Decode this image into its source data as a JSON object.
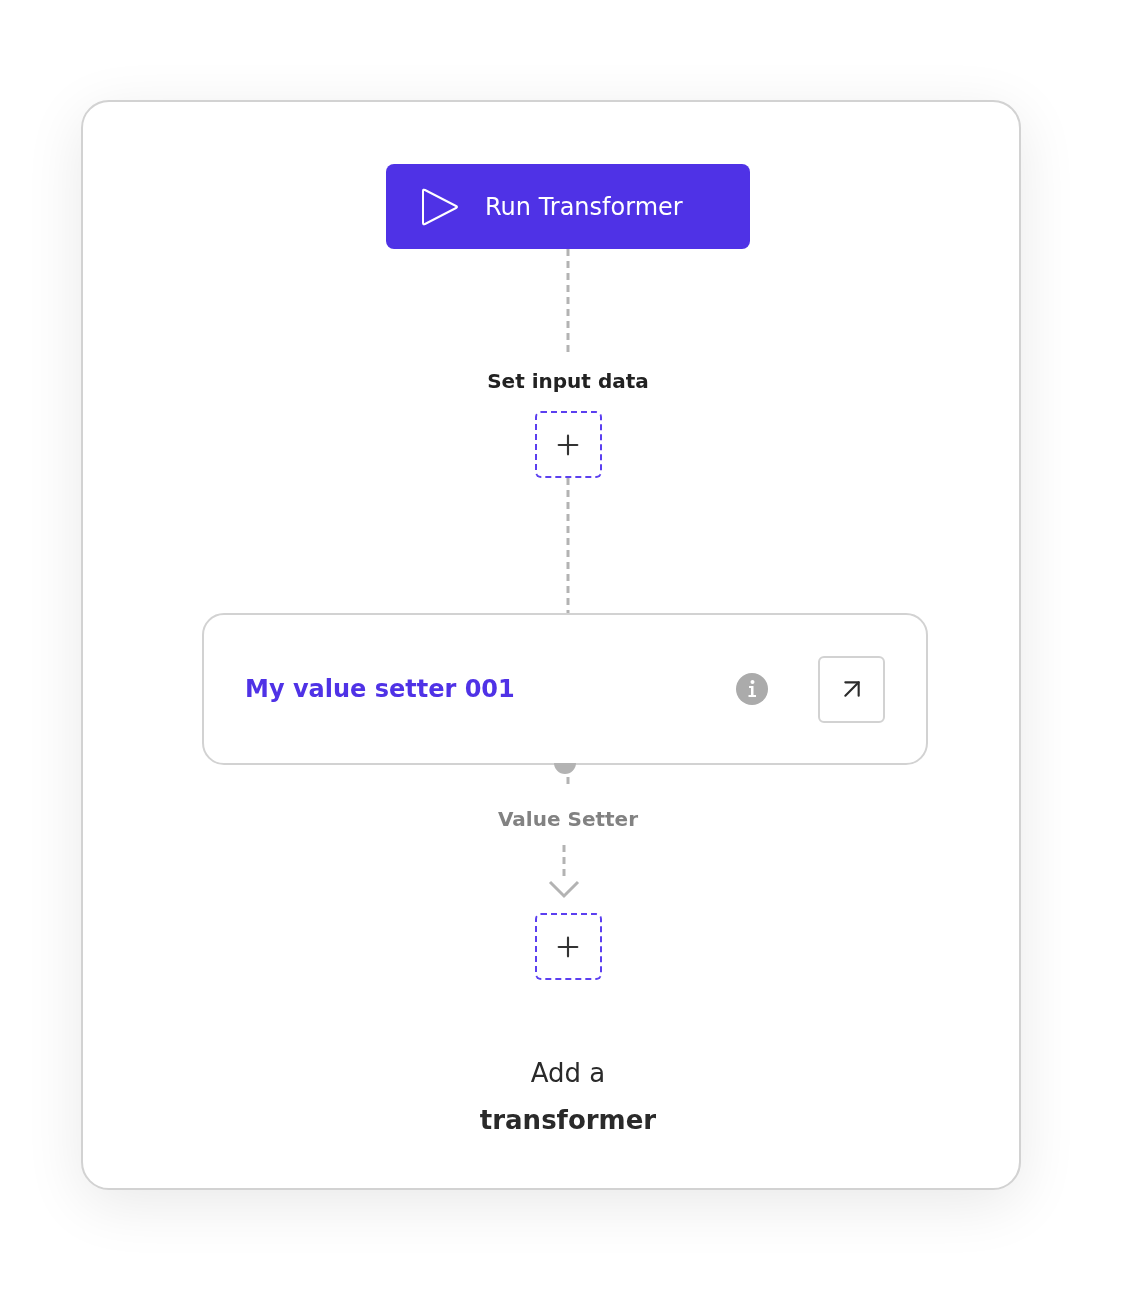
{
  "run_button": {
    "label": "Run Transformer"
  },
  "input_step": {
    "label": "Set input data"
  },
  "node": {
    "title": "My value setter 001",
    "type_label": "Value Setter"
  },
  "add_transformer": {
    "label": "Add a **transformer**"
  }
}
